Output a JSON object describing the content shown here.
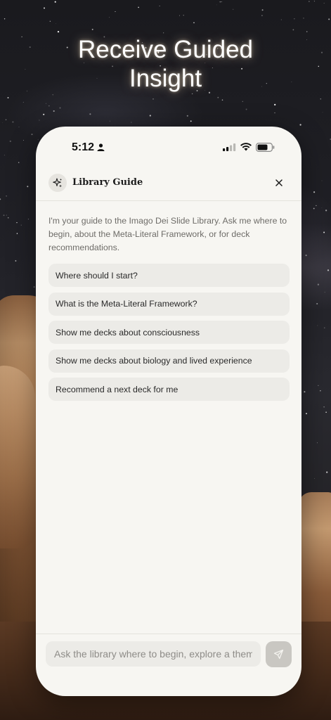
{
  "headline": {
    "line1": "Receive Guided",
    "line2": "Insight"
  },
  "status_bar": {
    "time": "5:12",
    "icons": [
      "person-icon",
      "signal-icon",
      "wifi-icon",
      "battery-icon"
    ]
  },
  "guide": {
    "title": "Library Guide",
    "avatar_icon": "sparkle-icon",
    "close_icon": "close-icon",
    "intro": "I'm your guide to the Imago Dei Slide Library. Ask me where to begin, about the Meta-Literal Framework, or for deck recommendations.",
    "suggestions": [
      "Where should I start?",
      "What is the Meta-Literal Framework?",
      "Show me decks about consciousness",
      "Show me decks about biology and lived experience",
      "Recommend a next deck for me"
    ]
  },
  "composer": {
    "placeholder": "Ask the library where to begin, explore a theme",
    "send_icon": "send-icon"
  },
  "colors": {
    "panel": "#f7f6f2",
    "chip": "#ecebe7",
    "send_button": "#c9c7c2"
  }
}
